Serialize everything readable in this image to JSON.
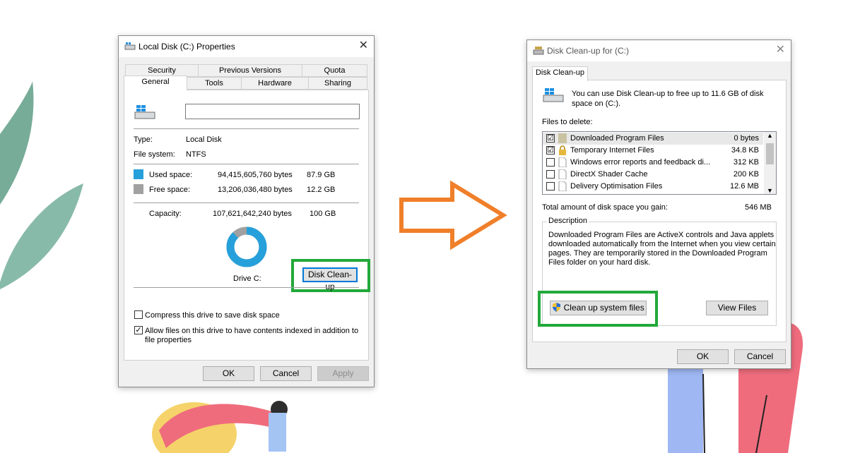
{
  "left_window": {
    "title": "Local Disk (C:) Properties",
    "tabs_top": [
      "Security",
      "Previous Versions",
      "Quota"
    ],
    "tabs_bottom": [
      "General",
      "Tools",
      "Hardware",
      "Sharing"
    ],
    "name_value": "",
    "type_label": "Type:",
    "type_value": "Local Disk",
    "fs_label": "File system:",
    "fs_value": "NTFS",
    "used_label": "Used space:",
    "used_bytes": "94,415,605,760 bytes",
    "used_gb": "87.9 GB",
    "free_label": "Free space:",
    "free_bytes": "13,206,036,480 bytes",
    "free_gb": "12.2 GB",
    "capacity_label": "Capacity:",
    "capacity_bytes": "107,621,642,240 bytes",
    "capacity_gb": "100 GB",
    "drive_label": "Drive C:",
    "cleanup_button": "Disk Clean-up",
    "compress_label": "Compress this drive to save disk space",
    "index_label_1": "Allow files on this drive to have contents indexed in addition to",
    "index_label_2": "file properties",
    "ok": "OK",
    "cancel": "Cancel",
    "apply": "Apply",
    "used_fraction": 0.879,
    "colors": {
      "used": "#26a0da",
      "free": "#a0a0a0"
    }
  },
  "right_window": {
    "title": "Disk Clean-up for  (C:)",
    "tab": "Disk Clean-up",
    "intro_1": "You can use Disk Clean-up to free up to 11.6 GB of disk",
    "intro_2": "space on  (C:).",
    "files_label": "Files to delete:",
    "files": [
      {
        "name": "Downloaded Program Files",
        "size": "0 bytes",
        "checked": "☑"
      },
      {
        "name": "Temporary Internet Files",
        "size": "34.8 KB",
        "checked": "☑"
      },
      {
        "name": "Windows error reports and feedback di...",
        "size": "312 KB",
        "checked": ""
      },
      {
        "name": "DirectX Shader Cache",
        "size": "200 KB",
        "checked": ""
      },
      {
        "name": "Delivery Optimisation Files",
        "size": "12.6 MB",
        "checked": ""
      }
    ],
    "total_label": "Total amount of disk space you gain:",
    "total_value": "546 MB",
    "description_label": "Description",
    "description_lines": [
      "Downloaded Program Files are ActiveX controls and Java applets",
      "downloaded automatically from the Internet when you view certain",
      "pages. They are temporarily stored in the Downloaded Program",
      "Files folder on your hard disk."
    ],
    "clean_system_button": "Clean up system files",
    "view_files_button": "View Files",
    "ok": "OK",
    "cancel": "Cancel"
  },
  "arrow_color": "#f07f2a",
  "highlight_color": "#22a83a"
}
